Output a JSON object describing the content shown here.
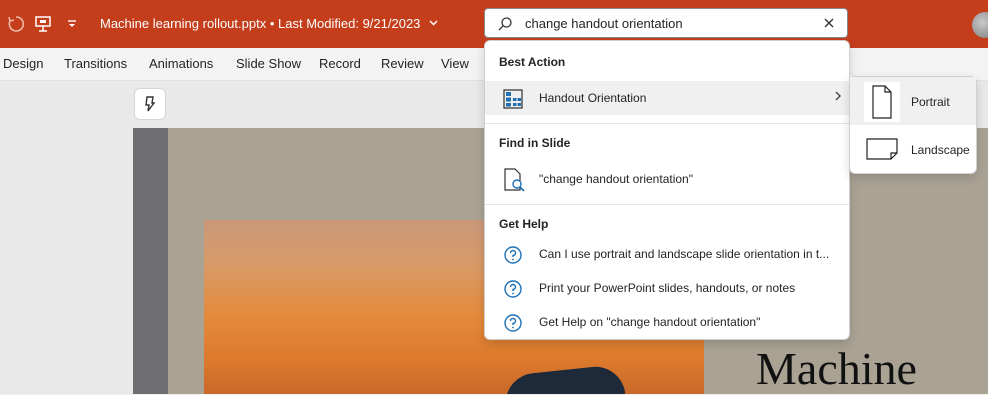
{
  "titlebar": {
    "document_title": "Machine learning rollout.pptx",
    "separator": "•",
    "last_modified": "Last Modified: 9/21/2023",
    "icons": [
      "autosave-icon",
      "presenter-icon",
      "customize-qat-icon",
      "chevron-down-icon"
    ],
    "accent_color": "#c43e1c"
  },
  "ribbon": {
    "tabs": [
      "Design",
      "Transitions",
      "Animations",
      "Slide Show",
      "Record",
      "Review",
      "View"
    ]
  },
  "search": {
    "query": "change handout orientation",
    "icons": [
      "search-icon",
      "close-icon"
    ]
  },
  "dropdown": {
    "best_action": {
      "heading": "Best Action",
      "item": "Handout Orientation",
      "icon": "handout-orientation-icon"
    },
    "find_in_slide": {
      "heading": "Find in Slide",
      "item": "\"change handout orientation\"",
      "icon": "find-document-icon"
    },
    "get_help": {
      "heading": "Get Help",
      "items": [
        "Can I use portrait and landscape slide orientation in t...",
        "Print your PowerPoint slides, handouts, or notes",
        "Get Help on \"change handout orientation\""
      ],
      "icon": "help-icon"
    }
  },
  "submenu": {
    "items": [
      "Portrait",
      "Landscape"
    ]
  },
  "slide": {
    "title_fragment": "Machine"
  }
}
